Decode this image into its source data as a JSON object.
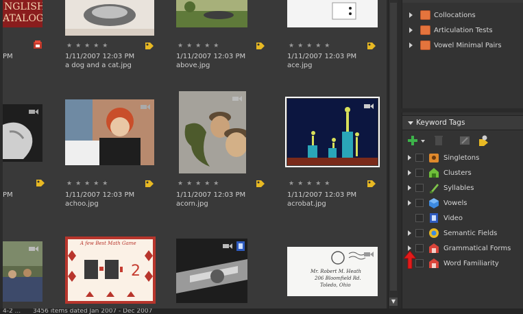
{
  "grid": {
    "rows": [
      {
        "items": [
          {
            "date": "",
            "name": ""
          },
          {
            "date": "1/11/2007 12:03 PM",
            "name": "a dog and a cat.jpg"
          },
          {
            "date": "1/11/2007 12:03 PM",
            "name": "above.jpg"
          },
          {
            "date": "1/11/2007 12:03 PM",
            "name": "ace.jpg"
          }
        ],
        "left_partial_text": "PM"
      },
      {
        "items": [
          {
            "date": "",
            "name": ""
          },
          {
            "date": "1/11/2007 12:03 PM",
            "name": "achoo.jpg"
          },
          {
            "date": "1/11/2007 12:03 PM",
            "name": "acorn.jpg"
          },
          {
            "date": "1/11/2007 12:03 PM",
            "name": "acrobat.jpg"
          }
        ],
        "left_partial_text": "PM"
      }
    ],
    "stars": "★★★★★",
    "catalog_logo_text": [
      "NGLISH",
      "ATALOG"
    ],
    "card_header_text": "A few Best Math Game",
    "card_number": "2",
    "envelope_text": [
      "Mr. Robert M. Heath",
      "206 Bloomfield Rd.",
      "Toledo, Ohio"
    ]
  },
  "collections": {
    "items": [
      {
        "label": "Collocations"
      },
      {
        "label": "Articulation Tests"
      },
      {
        "label": "Vowel Minimal Pairs"
      }
    ],
    "icon_color": "#e4743d"
  },
  "keyword_tags": {
    "header": "Keyword Tags",
    "items": [
      {
        "label": "Singletons",
        "icon": "singleton-icon",
        "has_children": true
      },
      {
        "label": "Clusters",
        "icon": "cluster-icon",
        "has_children": true
      },
      {
        "label": "Syllables",
        "icon": "syllable-icon",
        "has_children": true
      },
      {
        "label": "Vowels",
        "icon": "vowel-icon",
        "has_children": true
      },
      {
        "label": "Video",
        "icon": "video-icon",
        "has_children": false
      },
      {
        "label": "Semantic Fields",
        "icon": "semantic-icon",
        "has_children": true
      },
      {
        "label": "Grammatical Forms",
        "icon": "grammar-icon",
        "has_children": true
      },
      {
        "label": "Word Familiarity",
        "icon": "familiarity-icon",
        "has_children": false
      }
    ]
  },
  "status": {
    "left": "4-2 ...",
    "summary": "3456 items dated Jan 2007 - Dec 2007"
  },
  "colors": {
    "accent_orange": "#e4743d",
    "selection": "#ffffff",
    "add_green": "#3db34a",
    "arrow_red": "#e21b1b"
  }
}
